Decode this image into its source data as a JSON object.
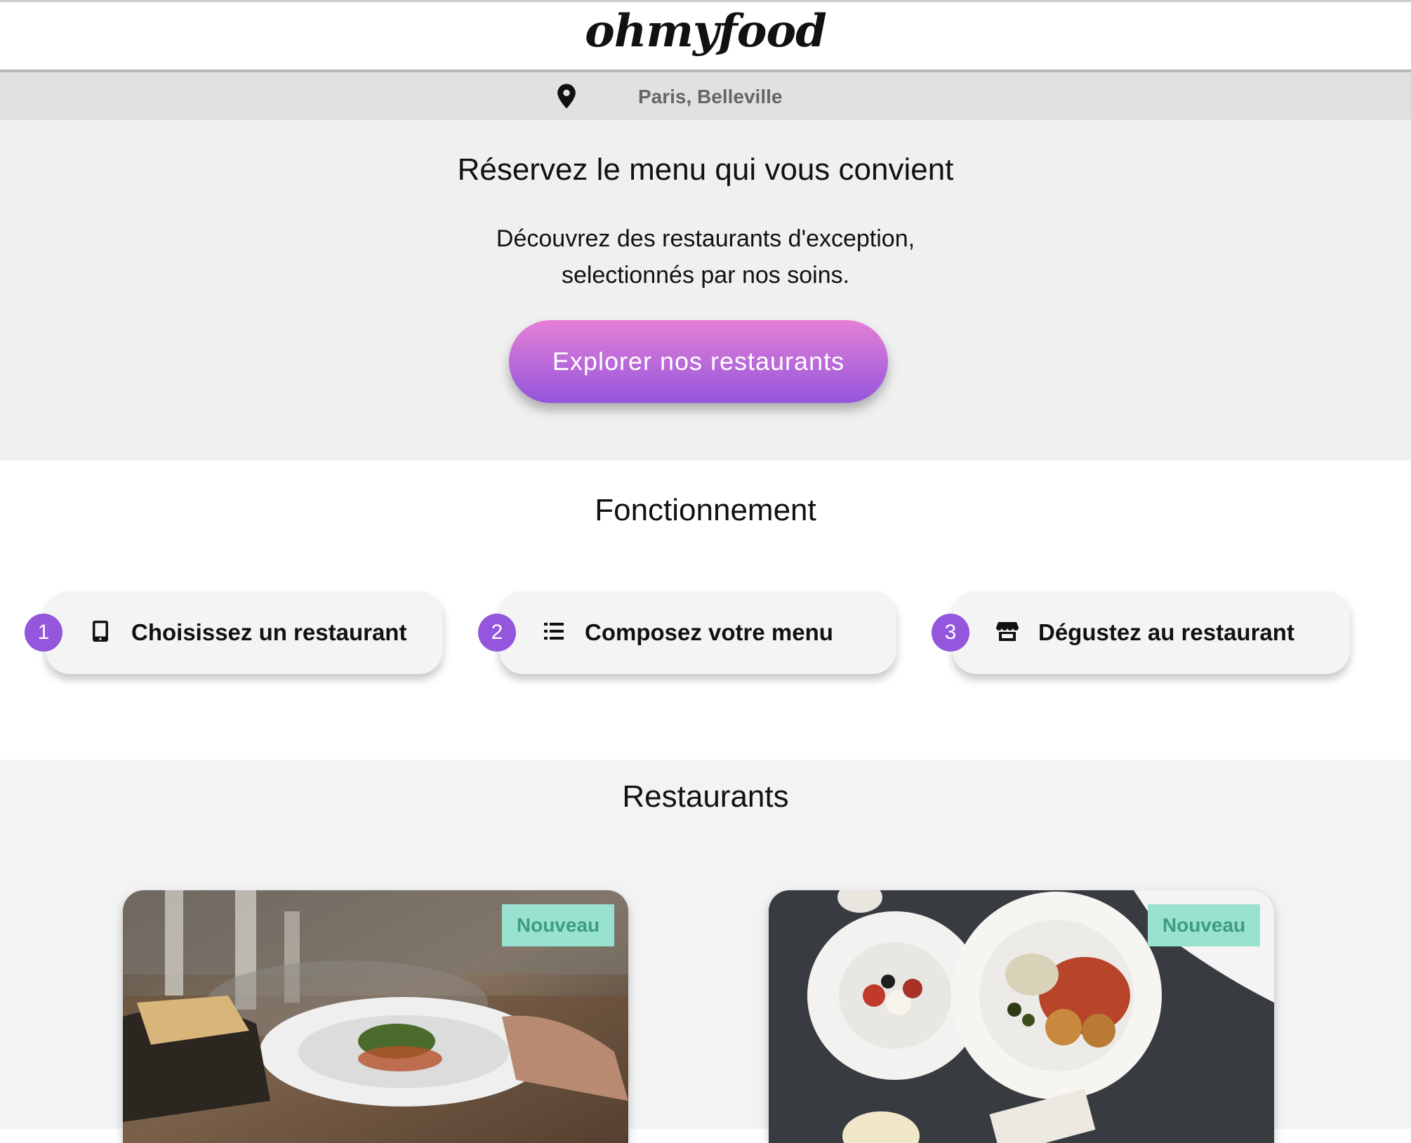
{
  "header": {
    "logo": "ohmyfood"
  },
  "location": {
    "icon": "map-pin-icon",
    "text": "Paris, Belleville"
  },
  "hero": {
    "title": "Réservez le menu qui vous convient",
    "description_line1": "Découvrez des restaurants d'exception,",
    "description_line2": "selectionnés par nos soins.",
    "cta_label": "Explorer nos restaurants"
  },
  "how_it_works": {
    "title": "Fonctionnement",
    "steps": [
      {
        "number": "1",
        "icon": "tablet-icon",
        "label": "Choisissez un restaurant"
      },
      {
        "number": "2",
        "icon": "list-icon",
        "label": "Composez votre menu"
      },
      {
        "number": "3",
        "icon": "store-icon",
        "label": "Dégustez au restaurant"
      }
    ]
  },
  "restaurants": {
    "title": "Restaurants",
    "cards": [
      {
        "badge": "Nouveau"
      },
      {
        "badge": "Nouveau"
      }
    ]
  },
  "colors": {
    "accent_purple": "#9356dc",
    "accent_pink": "#e67fd7",
    "badge_bg": "#99e2cf",
    "badge_text": "#3d9d7f"
  }
}
